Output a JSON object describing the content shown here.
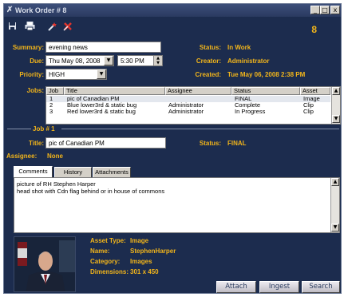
{
  "window": {
    "title": "Work Order # 8",
    "controls": {
      "minimize": "_",
      "maximize": "□",
      "close": "x"
    }
  },
  "toolbar": {
    "icons": [
      "save-icon",
      "print-icon",
      "wand-icon",
      "delete-icon"
    ],
    "work_order_number": "8"
  },
  "form": {
    "summary_label": "Summary:",
    "summary_value": "evening news",
    "due_label": "Due:",
    "due_date": "Thu May 08, 2008",
    "due_time": "5:30 PM",
    "priority_label": "Priority:",
    "priority_value": "HIGH",
    "status_label": "Status:",
    "status_value": "In Work",
    "creator_label": "Creator:",
    "creator_value": "Administrator",
    "created_label": "Created:",
    "created_value": "Tue May 06, 2008 2:38 PM"
  },
  "jobs": {
    "label": "Jobs:",
    "columns": [
      "Job",
      "Title",
      "Assignee",
      "Status",
      "Asset"
    ],
    "rows": [
      {
        "job": "1",
        "title": "pic of Canadian PM",
        "assignee": "",
        "status": "FINAL",
        "asset": "Image"
      },
      {
        "job": "2",
        "title": "Blue lower3rd & static bug",
        "assignee": "Administrator",
        "status": "Complete",
        "asset": "Clip"
      },
      {
        "job": "3",
        "title": "Red lower3rd & static bug",
        "assignee": "Administrator",
        "status": "In Progress",
        "asset": "Clip"
      }
    ]
  },
  "job_detail": {
    "header": "Job # 1",
    "title_label": "Title:",
    "title_value": "pic of Canadian PM",
    "status_label": "Status:",
    "status_value": "FINAL",
    "assignee_label": "Assignee:",
    "assignee_value": "None"
  },
  "tabs": [
    "Comments",
    "History",
    "Attachments"
  ],
  "comments": {
    "line1": "picture of RH Stephen Harper",
    "line2": "head shot with Cdn flag behind or in house of commons"
  },
  "asset": {
    "type_label": "Asset Type:",
    "type_value": "Image",
    "name_label": "Name:",
    "name_value": "StephenHarper",
    "category_label": "Category:",
    "category_value": "Images",
    "dimensions_label": "Dimensions:",
    "dimensions_value": "301 x 450"
  },
  "buttons": {
    "attach": "Attach",
    "ingest": "Ingest",
    "search": "Search"
  },
  "colors": {
    "background": "#1c2c4e",
    "accent": "#f2b51a",
    "field": "#ffffff"
  }
}
